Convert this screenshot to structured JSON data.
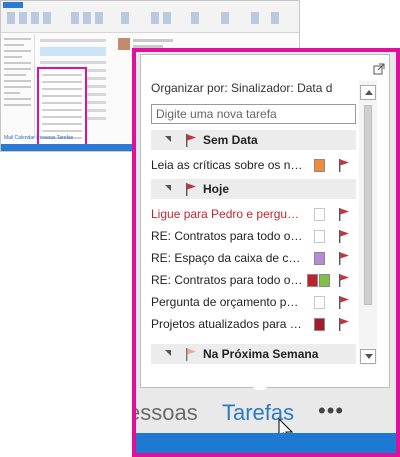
{
  "colors": {
    "highlight": "#e0109a",
    "accent_blue": "#1e79d2",
    "flag_red": "#c8323a",
    "flag_pale": "#f0a49a",
    "cat_orange": "#f08a3c",
    "cat_purple": "#b58ad6",
    "cat_red": "#c0202a",
    "cat_green": "#7ec04a",
    "cat_darkred": "#a21e2a",
    "overdue_text": "#c4262e"
  },
  "panel": {
    "popout_icon": "popout-icon",
    "sort_label": "Organizar por: Sinalizador: Data d",
    "new_task_placeholder": "Digite uma nova tarefa"
  },
  "groups": [
    {
      "label": "Sem Data",
      "flag": "red"
    },
    {
      "label": "Hoje",
      "flag": "red"
    },
    {
      "label": "Na Próxima Semana",
      "flag": "pale"
    }
  ],
  "tasks": [
    {
      "text": "Leia as críticas sobre os novo...",
      "overdue": false,
      "categories": [
        "cat_orange"
      ]
    },
    {
      "text": "Ligue para Pedro e pergunte...",
      "overdue": true,
      "categories": []
    },
    {
      "text": "RE: Contratos para todo o m...",
      "overdue": false,
      "categories": []
    },
    {
      "text": "RE: Espaço da caixa de correi...",
      "overdue": false,
      "categories": [
        "cat_purple"
      ]
    },
    {
      "text": "RE: Contratos para todo o m...",
      "overdue": false,
      "categories": [
        "cat_red",
        "cat_green"
      ]
    },
    {
      "text": "Pergunta de orçamento para...",
      "overdue": false,
      "categories": []
    },
    {
      "text": "Projetos atualizados para a p...",
      "overdue": false,
      "categories": [
        "cat_darkred"
      ]
    }
  ],
  "nav": {
    "people": "essoas",
    "tasks": "Tarefas",
    "more": "•••"
  },
  "thumbnail": {
    "nav_text": "Mail  Calendar  Pessoas  Tarefas"
  }
}
